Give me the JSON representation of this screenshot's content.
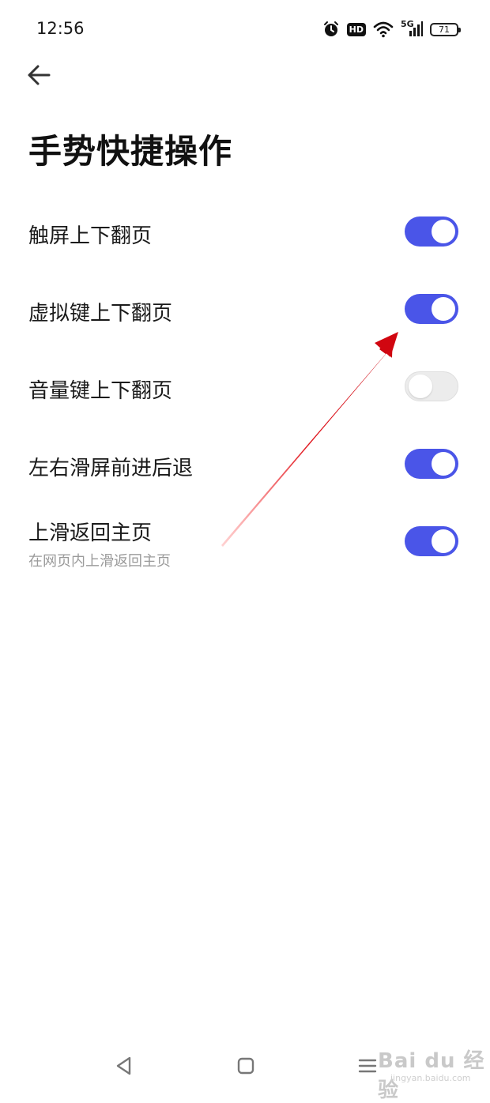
{
  "status_bar": {
    "time": "12:56",
    "network": "5G",
    "hd_label": "HD",
    "battery": "71",
    "icons": [
      "alarm-icon",
      "hd-icon",
      "wifi-icon",
      "signal-icon",
      "battery-icon"
    ]
  },
  "header": {
    "back_icon": "arrow-left-icon",
    "title": "手势快捷操作"
  },
  "settings": [
    {
      "label": "触屏上下翻页",
      "enabled": true
    },
    {
      "label": "虚拟键上下翻页",
      "enabled": true
    },
    {
      "label": "音量键上下翻页",
      "enabled": false
    },
    {
      "label": "左右滑屏前进后退",
      "enabled": true
    },
    {
      "label": "上滑返回主页",
      "sublabel": "在网页内上滑返回主页",
      "enabled": true
    }
  ],
  "nav_bar": {
    "icons": [
      "back-triangle-icon",
      "home-square-icon",
      "menu-icon"
    ]
  },
  "watermark": {
    "text": "Bai du 经验",
    "url": "jingyan.baidu.com"
  },
  "colors": {
    "toggle_on": "#4a55e8",
    "toggle_off": "#ececec",
    "annotation_arrow": "#e0141c"
  }
}
